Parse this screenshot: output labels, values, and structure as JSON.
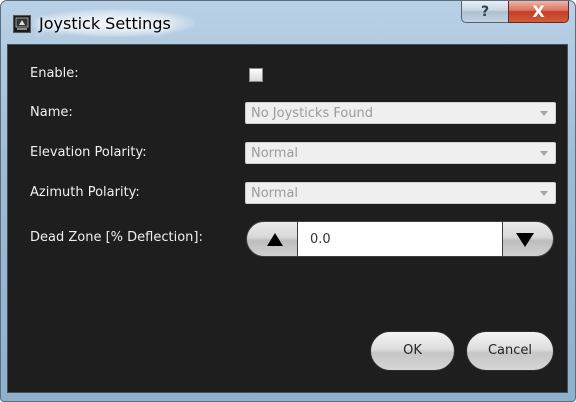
{
  "window": {
    "title": "Joystick Settings",
    "help_label": "?",
    "close_label": "X"
  },
  "form": {
    "enable_label": "Enable:",
    "enable_checked": false,
    "name_label": "Name:",
    "name_value": "No Joysticks Found",
    "elevation_label": "Elevation Polarity:",
    "elevation_value": "Normal",
    "azimuth_label": "Azimuth Polarity:",
    "azimuth_value": "Normal",
    "deadzone_label": "Dead Zone [% Deflection]:",
    "deadzone_value": "0.0"
  },
  "buttons": {
    "ok_label": "OK",
    "cancel_label": "Cancel"
  },
  "colors": {
    "client_bg": "#1e1e1e",
    "label_text": "#f0f0f0",
    "close_red": "#c43e26"
  }
}
